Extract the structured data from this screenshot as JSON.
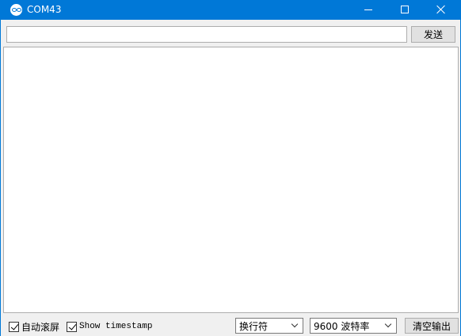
{
  "window": {
    "title": "COM43",
    "app_icon": "arduino-infinity-icon",
    "controls": [
      "minimize-icon",
      "maximize-icon",
      "close-icon"
    ]
  },
  "send_bar": {
    "input_value": "",
    "send_label": "发送"
  },
  "output": {
    "text": ""
  },
  "footer": {
    "autoscroll_label": "自动滚屏",
    "autoscroll_checked": true,
    "timestamp_label": "Show timestamp",
    "timestamp_checked": true,
    "line_ending_selected": "换行符",
    "baud_selected": "9600 波特率",
    "clear_label": "清空输出"
  },
  "colors": {
    "titlebar": "#0078d7",
    "client_bg": "#f0f0f0",
    "button_bg": "#e1e1e1"
  }
}
